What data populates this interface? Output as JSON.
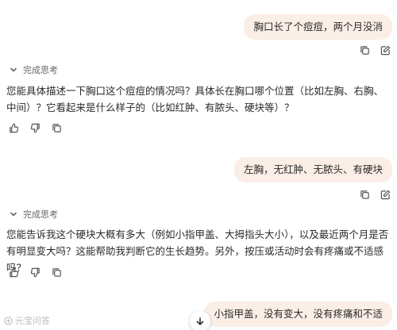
{
  "messages": [
    {
      "role": "user",
      "text": "胸口长了个痘痘，两个月没消"
    },
    {
      "role": "assistant",
      "thinking_label": "完成思考",
      "text": "您能具体描述一下胸口这个痘痘的情况吗？具体长在胸口哪个位置（比如左胸、右胸、中间）？它看起来是什么样子的（比如红肿、有脓头、硬块等）？"
    },
    {
      "role": "user",
      "text": "左胸，无红肿、无脓头、有硬块"
    },
    {
      "role": "assistant",
      "thinking_label": "完成思考",
      "text": "您能告诉我这个硬块大概有多大（例如小指甲盖、大拇指头大小），以及最近两个月是否有明显变大吗？这能帮助我判断它的生长趋势。另外，按压或活动时会有疼痛或不适感吗？"
    },
    {
      "role": "user",
      "text": "小指甲盖，没有变大，没有疼痛和不适"
    }
  ],
  "watermark": "元宝问答",
  "icons": {
    "copy": "copy-icon",
    "edit": "edit-icon",
    "thumbs_up": "thumbs-up-icon",
    "thumbs_down": "thumbs-down-icon",
    "expand": "chevron-down-icon",
    "scroll_down": "arrow-down-icon"
  }
}
